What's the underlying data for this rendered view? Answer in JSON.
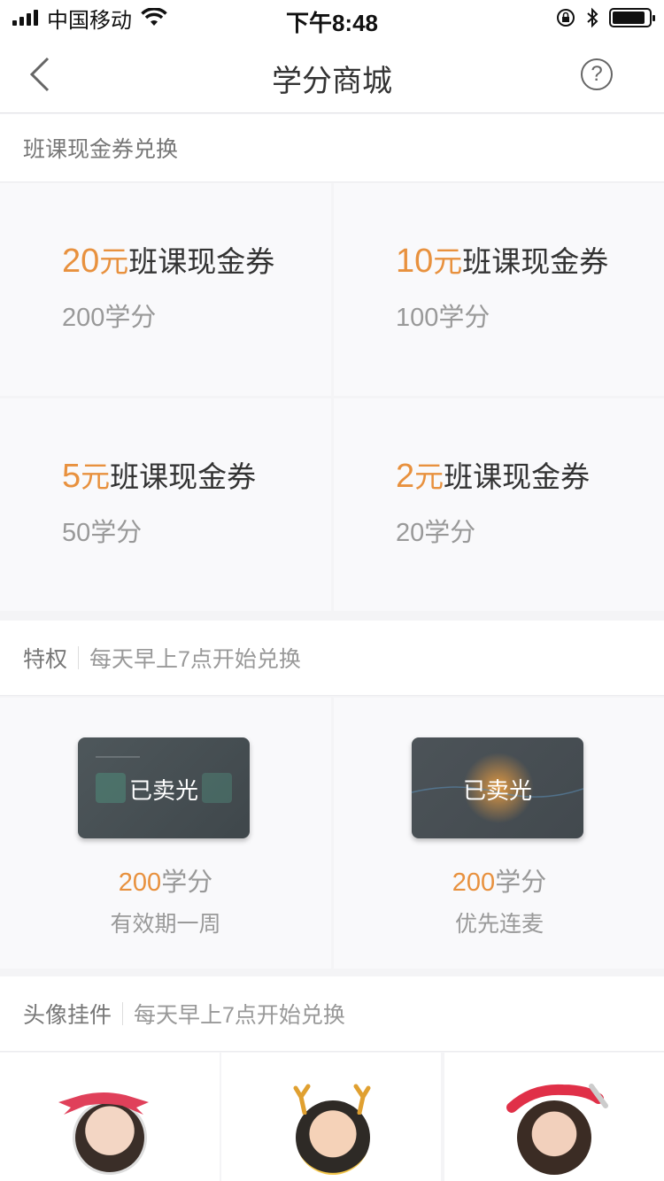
{
  "status_bar": {
    "carrier": "中国移动",
    "time": "下午8:48"
  },
  "nav": {
    "title": "学分商城",
    "help_glyph": "?"
  },
  "coupon_section": {
    "title": "班课现金券兑换",
    "items": [
      {
        "amount": "20",
        "unit": "元",
        "name": "班课现金券",
        "points": "200学分"
      },
      {
        "amount": "10",
        "unit": "元",
        "name": "班课现金券",
        "points": "100学分"
      },
      {
        "amount": "5",
        "unit": "元",
        "name": "班课现金券",
        "points": "50学分"
      },
      {
        "amount": "2",
        "unit": "元",
        "name": "班课现金券",
        "points": "20学分"
      }
    ]
  },
  "privilege_section": {
    "title": "特权",
    "subtitle": "每天早上7点开始兑换",
    "items": [
      {
        "badge": "已卖光",
        "points_num": "200",
        "points_unit": "学分",
        "desc": "有效期一周"
      },
      {
        "badge": "已卖光",
        "points_num": "200",
        "points_unit": "学分",
        "desc": "优先连麦"
      }
    ]
  },
  "avatar_section": {
    "title": "头像挂件",
    "subtitle": "每天早上7点开始兑换"
  },
  "colors": {
    "accent_orange": "#e8913e",
    "muted_text": "#999999",
    "background": "#f4f4f6"
  }
}
